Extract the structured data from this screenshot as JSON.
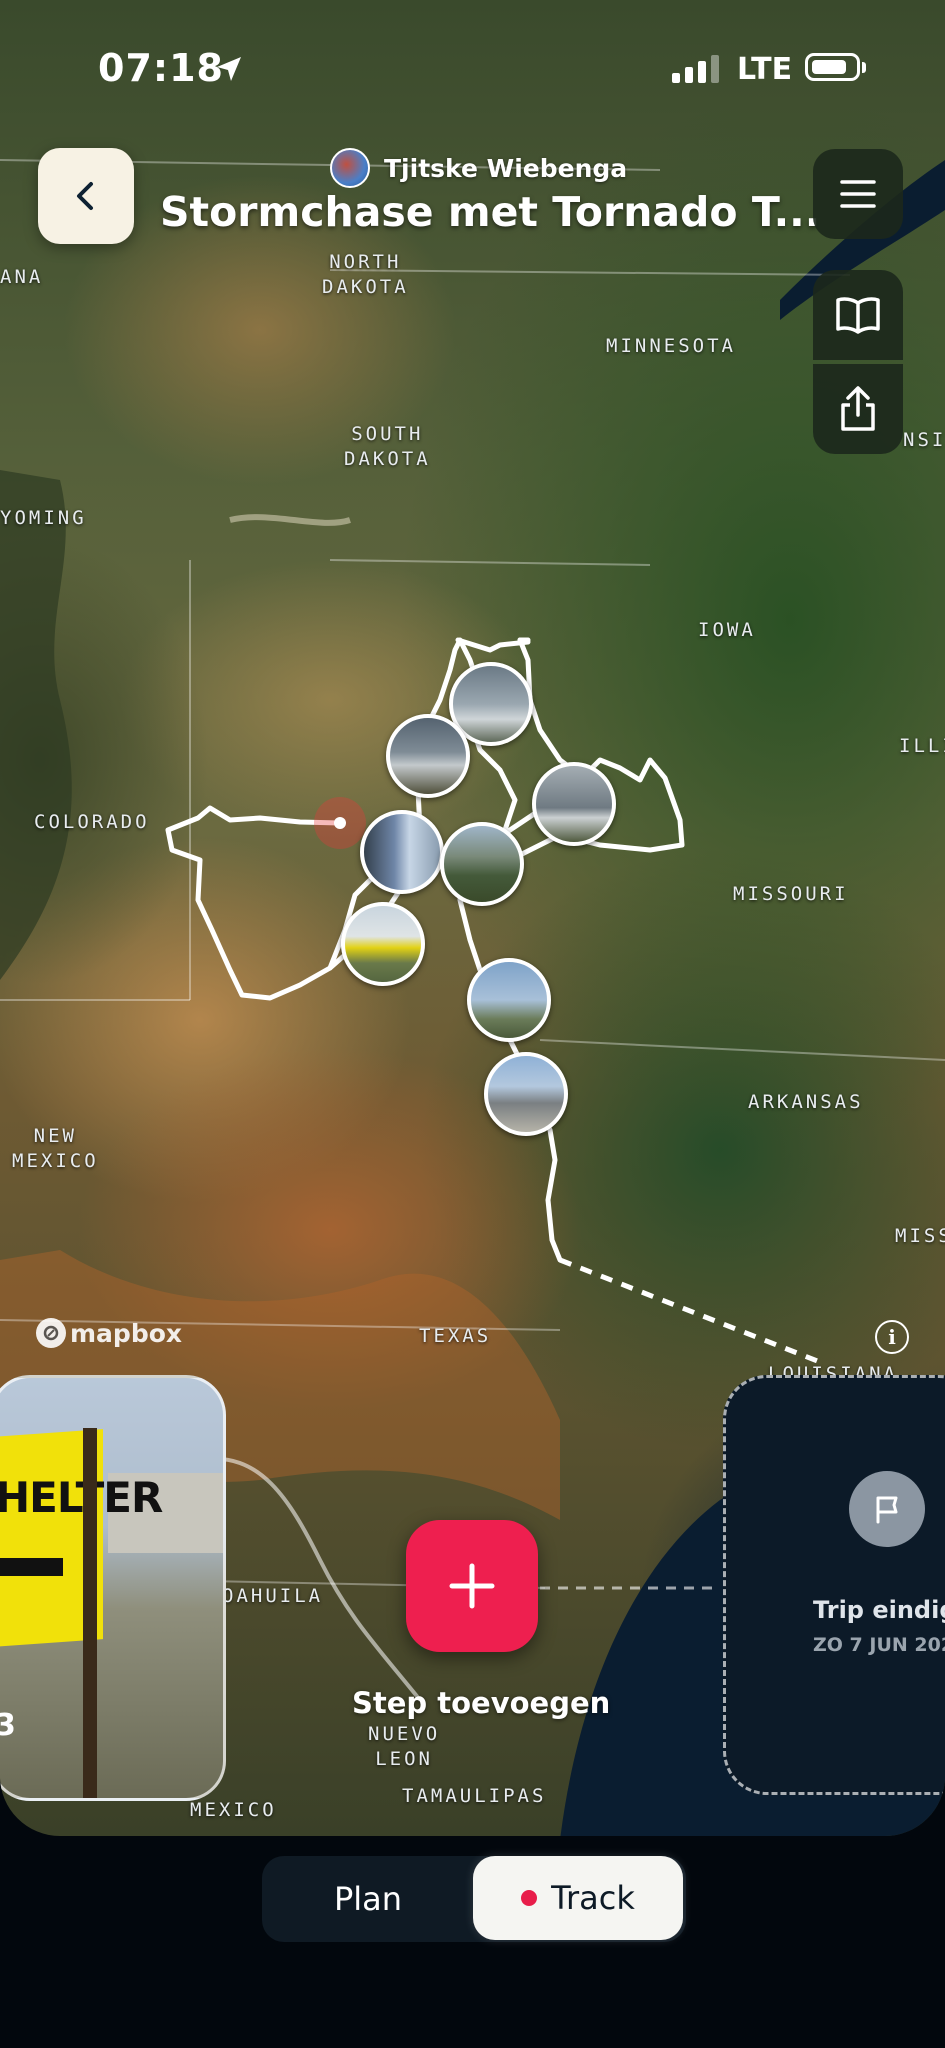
{
  "status_bar": {
    "time": "07:18",
    "network": "LTE"
  },
  "header": {
    "author": "Tjitske Wiebenga",
    "title": "Stormchase met Tornado T..."
  },
  "map": {
    "labels": {
      "north_dakota": "NORTH\nDAKOTA",
      "minnesota": "MINNESOTA",
      "south_dakota": "SOUTH\nDAKOTA",
      "wyoming": "YOMING",
      "iowa": "IOWA",
      "colorado": "COLORADO",
      "illinois": "ILLI",
      "missouri": "MISSOURI",
      "arkansas": "ARKANSAS",
      "new_mexico": "NEW\nMEXICO",
      "mississippi": "MISS",
      "texas": "TEXAS",
      "louisiana": "LOUISIANA",
      "coahuila": "OAHUILA",
      "nuevo_leon": "NUEVO\nLEON",
      "tamaulipas": "TAMAULIPAS",
      "mexico": "MEXICO",
      "montana": "ANA",
      "wisconsin": "NSI"
    },
    "attribution": "mapbox"
  },
  "cards": {
    "left_step_number": "3",
    "left_sign_text": "HELTER",
    "trip_end_label": "Trip eindig",
    "trip_end_date": "ZO 7 JUN 202"
  },
  "actions": {
    "add_step": "Step toevoegen"
  },
  "mode_toggle": {
    "plan": "Plan",
    "track": "Track",
    "selected": "Track"
  },
  "colors": {
    "accent": "#ee1f4f",
    "route": "#ffffff"
  }
}
